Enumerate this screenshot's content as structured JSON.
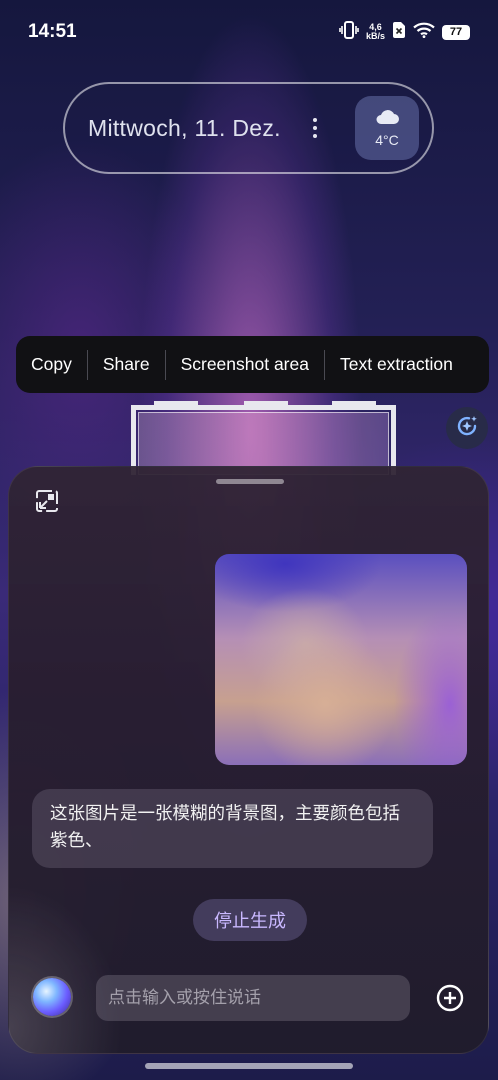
{
  "status_bar": {
    "time": "14:51",
    "net_speed_value": "4,6",
    "net_speed_unit": "kB/s",
    "battery": "77",
    "icons": [
      "vibrate-icon",
      "network-speed",
      "no-sim-icon",
      "wifi-icon",
      "battery-icon"
    ]
  },
  "widget": {
    "date": "Mittwoch, 11. Dez.",
    "weather_temp": "4°C",
    "weather_icon": "cloud-icon"
  },
  "context_menu": {
    "items": [
      "Copy",
      "Share",
      "Screenshot area",
      "Text extraction"
    ]
  },
  "assistant": {
    "reply": "这张图片是一张模糊的背景图，主要颜色包括紫色、",
    "stop_label": "停止生成",
    "input_placeholder": "点击输入或按住说话"
  },
  "colors": {
    "accent": "#c9b8ff",
    "menu_bg": "#111114"
  }
}
